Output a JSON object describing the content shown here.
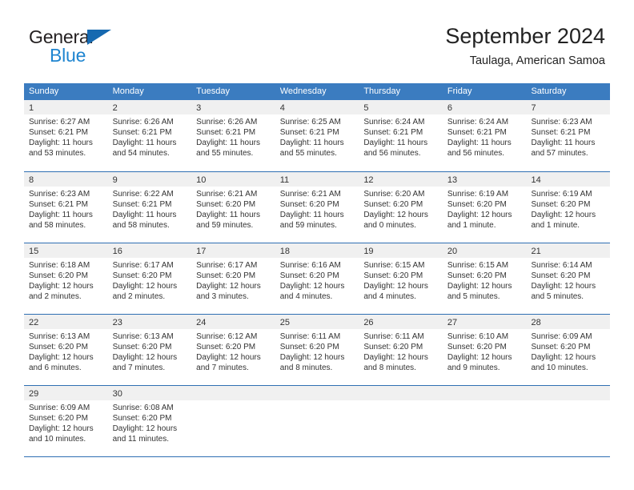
{
  "brand": {
    "name_part1": "General",
    "name_part2": "Blue",
    "accent_color": "#1f85d0",
    "triangle_color": "#1669b0"
  },
  "header": {
    "title": "September 2024",
    "subtitle": "Taulaga, American Samoa"
  },
  "theme": {
    "header_blue": "#3b7cc0",
    "separator_blue": "#2f6fb3",
    "daynum_band": "#f0f0f0"
  },
  "weekdays": [
    "Sunday",
    "Monday",
    "Tuesday",
    "Wednesday",
    "Thursday",
    "Friday",
    "Saturday"
  ],
  "weeks": [
    [
      {
        "day": "1",
        "sunrise": "Sunrise: 6:27 AM",
        "sunset": "Sunset: 6:21 PM",
        "daylight": "Daylight: 11 hours and 53 minutes."
      },
      {
        "day": "2",
        "sunrise": "Sunrise: 6:26 AM",
        "sunset": "Sunset: 6:21 PM",
        "daylight": "Daylight: 11 hours and 54 minutes."
      },
      {
        "day": "3",
        "sunrise": "Sunrise: 6:26 AM",
        "sunset": "Sunset: 6:21 PM",
        "daylight": "Daylight: 11 hours and 55 minutes."
      },
      {
        "day": "4",
        "sunrise": "Sunrise: 6:25 AM",
        "sunset": "Sunset: 6:21 PM",
        "daylight": "Daylight: 11 hours and 55 minutes."
      },
      {
        "day": "5",
        "sunrise": "Sunrise: 6:24 AM",
        "sunset": "Sunset: 6:21 PM",
        "daylight": "Daylight: 11 hours and 56 minutes."
      },
      {
        "day": "6",
        "sunrise": "Sunrise: 6:24 AM",
        "sunset": "Sunset: 6:21 PM",
        "daylight": "Daylight: 11 hours and 56 minutes."
      },
      {
        "day": "7",
        "sunrise": "Sunrise: 6:23 AM",
        "sunset": "Sunset: 6:21 PM",
        "daylight": "Daylight: 11 hours and 57 minutes."
      }
    ],
    [
      {
        "day": "8",
        "sunrise": "Sunrise: 6:23 AM",
        "sunset": "Sunset: 6:21 PM",
        "daylight": "Daylight: 11 hours and 58 minutes."
      },
      {
        "day": "9",
        "sunrise": "Sunrise: 6:22 AM",
        "sunset": "Sunset: 6:21 PM",
        "daylight": "Daylight: 11 hours and 58 minutes."
      },
      {
        "day": "10",
        "sunrise": "Sunrise: 6:21 AM",
        "sunset": "Sunset: 6:20 PM",
        "daylight": "Daylight: 11 hours and 59 minutes."
      },
      {
        "day": "11",
        "sunrise": "Sunrise: 6:21 AM",
        "sunset": "Sunset: 6:20 PM",
        "daylight": "Daylight: 11 hours and 59 minutes."
      },
      {
        "day": "12",
        "sunrise": "Sunrise: 6:20 AM",
        "sunset": "Sunset: 6:20 PM",
        "daylight": "Daylight: 12 hours and 0 minutes."
      },
      {
        "day": "13",
        "sunrise": "Sunrise: 6:19 AM",
        "sunset": "Sunset: 6:20 PM",
        "daylight": "Daylight: 12 hours and 1 minute."
      },
      {
        "day": "14",
        "sunrise": "Sunrise: 6:19 AM",
        "sunset": "Sunset: 6:20 PM",
        "daylight": "Daylight: 12 hours and 1 minute."
      }
    ],
    [
      {
        "day": "15",
        "sunrise": "Sunrise: 6:18 AM",
        "sunset": "Sunset: 6:20 PM",
        "daylight": "Daylight: 12 hours and 2 minutes."
      },
      {
        "day": "16",
        "sunrise": "Sunrise: 6:17 AM",
        "sunset": "Sunset: 6:20 PM",
        "daylight": "Daylight: 12 hours and 2 minutes."
      },
      {
        "day": "17",
        "sunrise": "Sunrise: 6:17 AM",
        "sunset": "Sunset: 6:20 PM",
        "daylight": "Daylight: 12 hours and 3 minutes."
      },
      {
        "day": "18",
        "sunrise": "Sunrise: 6:16 AM",
        "sunset": "Sunset: 6:20 PM",
        "daylight": "Daylight: 12 hours and 4 minutes."
      },
      {
        "day": "19",
        "sunrise": "Sunrise: 6:15 AM",
        "sunset": "Sunset: 6:20 PM",
        "daylight": "Daylight: 12 hours and 4 minutes."
      },
      {
        "day": "20",
        "sunrise": "Sunrise: 6:15 AM",
        "sunset": "Sunset: 6:20 PM",
        "daylight": "Daylight: 12 hours and 5 minutes."
      },
      {
        "day": "21",
        "sunrise": "Sunrise: 6:14 AM",
        "sunset": "Sunset: 6:20 PM",
        "daylight": "Daylight: 12 hours and 5 minutes."
      }
    ],
    [
      {
        "day": "22",
        "sunrise": "Sunrise: 6:13 AM",
        "sunset": "Sunset: 6:20 PM",
        "daylight": "Daylight: 12 hours and 6 minutes."
      },
      {
        "day": "23",
        "sunrise": "Sunrise: 6:13 AM",
        "sunset": "Sunset: 6:20 PM",
        "daylight": "Daylight: 12 hours and 7 minutes."
      },
      {
        "day": "24",
        "sunrise": "Sunrise: 6:12 AM",
        "sunset": "Sunset: 6:20 PM",
        "daylight": "Daylight: 12 hours and 7 minutes."
      },
      {
        "day": "25",
        "sunrise": "Sunrise: 6:11 AM",
        "sunset": "Sunset: 6:20 PM",
        "daylight": "Daylight: 12 hours and 8 minutes."
      },
      {
        "day": "26",
        "sunrise": "Sunrise: 6:11 AM",
        "sunset": "Sunset: 6:20 PM",
        "daylight": "Daylight: 12 hours and 8 minutes."
      },
      {
        "day": "27",
        "sunrise": "Sunrise: 6:10 AM",
        "sunset": "Sunset: 6:20 PM",
        "daylight": "Daylight: 12 hours and 9 minutes."
      },
      {
        "day": "28",
        "sunrise": "Sunrise: 6:09 AM",
        "sunset": "Sunset: 6:20 PM",
        "daylight": "Daylight: 12 hours and 10 minutes."
      }
    ],
    [
      {
        "day": "29",
        "sunrise": "Sunrise: 6:09 AM",
        "sunset": "Sunset: 6:20 PM",
        "daylight": "Daylight: 12 hours and 10 minutes."
      },
      {
        "day": "30",
        "sunrise": "Sunrise: 6:08 AM",
        "sunset": "Sunset: 6:20 PM",
        "daylight": "Daylight: 12 hours and 11 minutes."
      },
      {
        "day": "",
        "sunrise": "",
        "sunset": "",
        "daylight": ""
      },
      {
        "day": "",
        "sunrise": "",
        "sunset": "",
        "daylight": ""
      },
      {
        "day": "",
        "sunrise": "",
        "sunset": "",
        "daylight": ""
      },
      {
        "day": "",
        "sunrise": "",
        "sunset": "",
        "daylight": ""
      },
      {
        "day": "",
        "sunrise": "",
        "sunset": "",
        "daylight": ""
      }
    ]
  ]
}
